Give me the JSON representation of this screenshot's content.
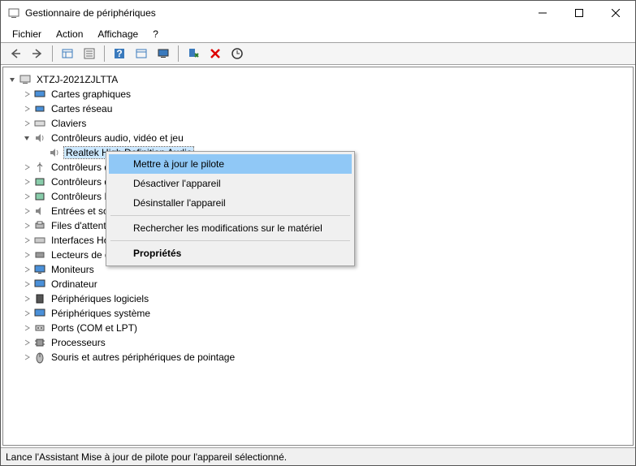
{
  "window": {
    "title": "Gestionnaire de périphériques"
  },
  "menubar": {
    "file": "Fichier",
    "action": "Action",
    "view": "Affichage",
    "help": "?"
  },
  "tree": {
    "root": "XTZJ-2021ZJLTTA",
    "graphics": "Cartes graphiques",
    "network": "Cartes réseau",
    "keyboards": "Claviers",
    "audio": "Contrôleurs audio, vidéo et jeu",
    "audio_item": "Realtek High Definition Audio",
    "bus": "Contrôleurs de bus USB",
    "storage": "Contrôleurs de stockage",
    "ide": "Contrôleurs IDE ATA/ATAPI",
    "inout": "Entrées et sorties audio",
    "printqueue": "Files d'attente à l'impression",
    "hid": "Interfaces Homme-machine",
    "disk": "Lecteurs de disque",
    "monitor": "Moniteurs",
    "computer": "Ordinateur",
    "soft": "Périphériques logiciels",
    "system": "Périphériques système",
    "ports": "Ports (COM et LPT)",
    "cpu": "Processeurs",
    "mouse": "Souris et autres périphériques de pointage"
  },
  "context_menu": {
    "update": "Mettre à jour le pilote",
    "disable": "Désactiver l'appareil",
    "uninstall": "Désinstaller l'appareil",
    "scan": "Rechercher les modifications sur le matériel",
    "properties": "Propriétés"
  },
  "status": "Lance l'Assistant Mise à jour de pilote pour l'appareil sélectionné."
}
